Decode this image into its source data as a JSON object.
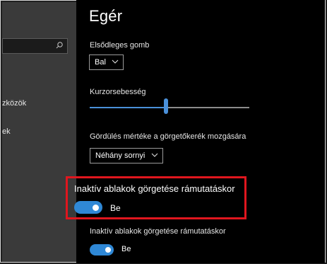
{
  "nav": {
    "search_placeholder": "",
    "items": [
      {
        "label": "zközök"
      },
      {
        "label": "ek"
      }
    ]
  },
  "main": {
    "title": "Egér",
    "primary_button": {
      "label": "Elsődleges gomb",
      "value": "Bal"
    },
    "cursor_speed": {
      "label": "Kurzorsebesség",
      "level_fraction": 0.48
    },
    "wheel_scroll": {
      "label": "Gördülés mértéke a görgetőkerék mozgására",
      "value": "Néhány sornyi"
    },
    "inactive_scroll_highlighted": {
      "label": "Inaktív ablakok görgetése rámutatáskor",
      "state": "Be",
      "on": true
    },
    "inactive_scroll": {
      "label": "Inaktív ablakok görgetése rámutatáskor",
      "state": "Be",
      "on": true
    }
  },
  "colors": {
    "accent": "#2f88d6",
    "highlight": "#e0161e"
  }
}
